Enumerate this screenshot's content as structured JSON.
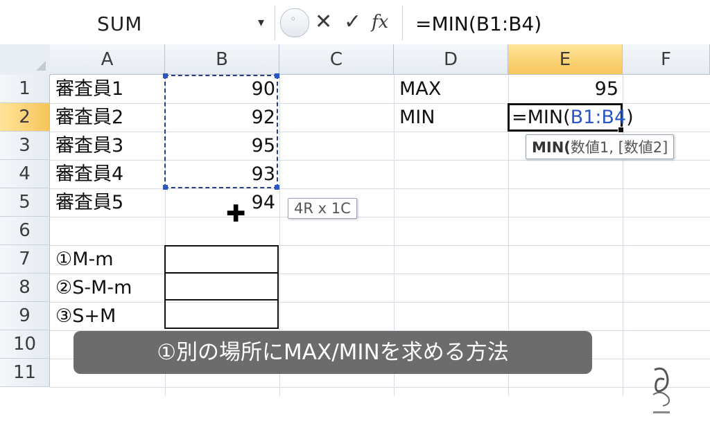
{
  "formula_bar": {
    "name_box": "SUM",
    "dropdown_arrow": "▾",
    "cancel_icon": "✕",
    "enter_icon": "✓",
    "fx_label": "fx",
    "formula": "=MIN(B1:B4)"
  },
  "columns": [
    "A",
    "B",
    "C",
    "D",
    "E",
    "F"
  ],
  "rows": [
    "1",
    "2",
    "3",
    "4",
    "5",
    "6",
    "7",
    "8",
    "9",
    "10",
    "11"
  ],
  "cells": {
    "A1": "審査員1",
    "A2": "審査員2",
    "A3": "審査員3",
    "A4": "審査員4",
    "A5": "審査員5",
    "A7": "①M-m",
    "A8": "②S-M-m",
    "A9": "③S+M",
    "B1": "90",
    "B2": "92",
    "B3": "95",
    "B4": "93",
    "B5": "94",
    "D1": "MAX",
    "D2": "MIN",
    "E1": "95"
  },
  "edit": {
    "prefix": "=MIN(",
    "ref": "B1:B4",
    "suffix": ")"
  },
  "tooltips": {
    "function_hint_name": "MIN(",
    "function_hint_args": "数値1, [数値2]",
    "selection_size": "4R x 1C"
  },
  "caption": "①別の場所にMAX/MINを求める方法",
  "colors": {
    "active_header": "#f7c55a",
    "reference_blue": "#2a56c6"
  },
  "icons": [
    "dropdown-arrow-icon",
    "cancel-icon",
    "enter-icon",
    "function-icon",
    "move-cursor-icon",
    "brand-logo-icon"
  ]
}
